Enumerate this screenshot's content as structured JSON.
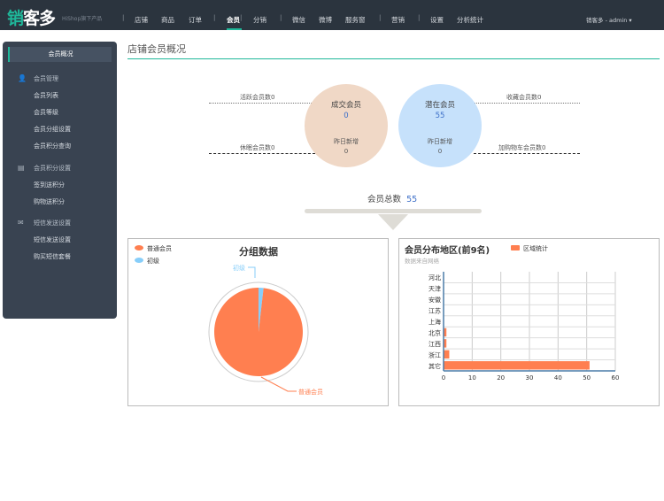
{
  "header": {
    "logo": "销客多",
    "logo_sub": "HiShop旗下产品",
    "nav": [
      "店铺",
      "商品",
      "订单",
      "会员",
      "分销",
      "微信",
      "微博",
      "服务窗",
      "营销",
      "设置",
      "分析统计"
    ],
    "active": "会员",
    "user": "销客多 - admin ▾"
  },
  "sidebar": {
    "active": "会员概况",
    "groups": [
      {
        "title": "会员管理",
        "icon": "users-icon",
        "items": [
          "会员列表",
          "会员等级",
          "会员分组设置",
          "会员积分查询"
        ]
      },
      {
        "title": "会员积分设置",
        "icon": "database-icon",
        "items": [
          "签到送积分",
          "购物送积分"
        ]
      },
      {
        "title": "短信发送设置",
        "icon": "envelope-icon",
        "items": [
          "短信发送设置",
          "购买短信套餐"
        ]
      }
    ]
  },
  "main": {
    "title": "店铺会员概况",
    "deal": {
      "title": "成交会员",
      "value": "0",
      "sub": "昨日新增",
      "sub_value": "0",
      "color": "#f0d8c6"
    },
    "potential": {
      "title": "潜在会员",
      "value": "55",
      "sub": "昨日新增",
      "sub_value": "0",
      "color": "#c6e1fb"
    },
    "stats": {
      "active": "活跃会员数0",
      "dormant": "休眠会员数0",
      "fav": "收藏会员数0",
      "cart": "加购物车会员数0"
    },
    "total_label": "会员总数",
    "total_value": "55"
  },
  "chart_data": [
    {
      "type": "pie",
      "title": "分组数据",
      "legend": [
        "普通会员",
        "初级"
      ],
      "legend_placement": "top-left",
      "slices": [
        {
          "name": "普通会员",
          "value": 54,
          "color": "#ff7f50"
        },
        {
          "name": "初级",
          "value": 1,
          "color": "#87cefa"
        }
      ]
    },
    {
      "type": "bar",
      "orientation": "horizontal",
      "title": "会员分布地区(前9名)",
      "subtitle": "数据来自网络",
      "legend": [
        "区域统计"
      ],
      "legend_placement": "top",
      "categories": [
        "河北",
        "天津",
        "安徽",
        "江苏",
        "上海",
        "北京",
        "江西",
        "浙江",
        "其它"
      ],
      "series": [
        {
          "name": "区域统计",
          "values": [
            0,
            0,
            0,
            0,
            0,
            1,
            1,
            2,
            51
          ],
          "color": "#ff7f50"
        }
      ],
      "xlim": [
        0,
        60
      ],
      "xticks": [
        0,
        10,
        20,
        30,
        40,
        50,
        60
      ],
      "grid": true
    }
  ]
}
